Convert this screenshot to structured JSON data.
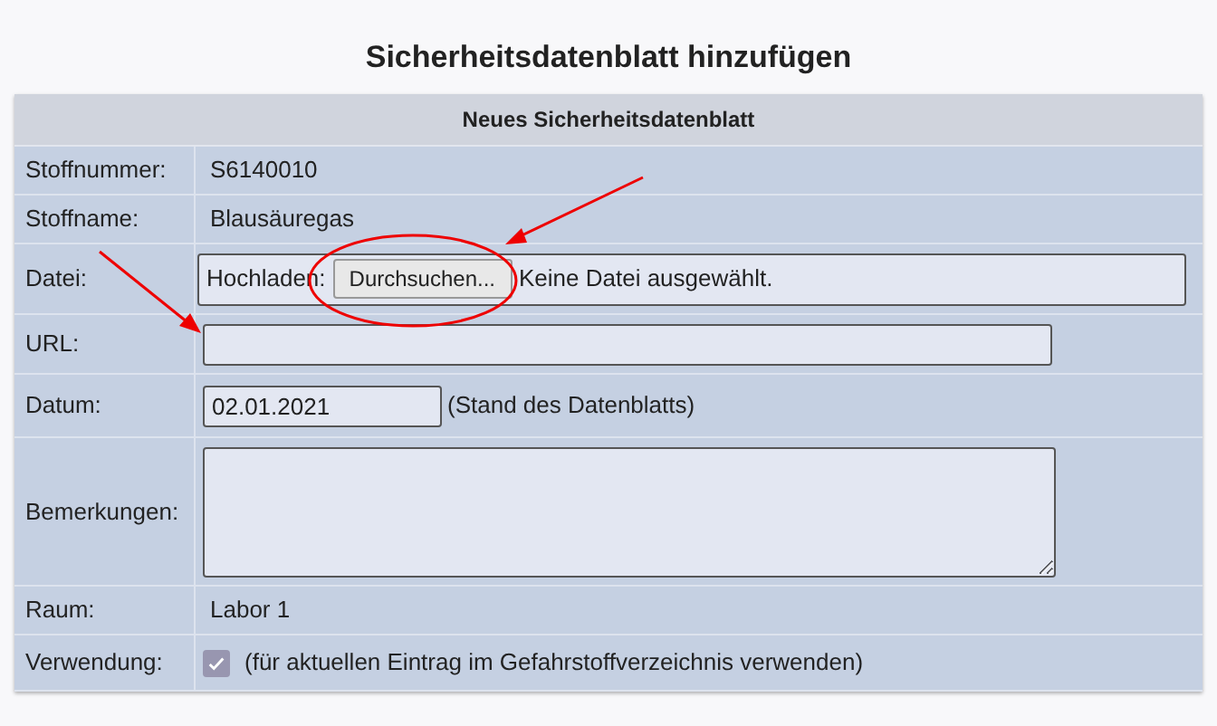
{
  "title": "Sicherheitsdatenblatt hinzufügen",
  "form": {
    "heading": "Neues Sicherheitsdatenblatt",
    "rows": [
      {
        "kind": "text",
        "label": "Stoffnummer:",
        "value": "S6140010"
      },
      {
        "kind": "text",
        "label": "Stoffname:",
        "value": "Blausäuregas"
      },
      {
        "kind": "file",
        "label": "Datei:",
        "prefix": "Hochladen:",
        "button": "Durchsuchen...",
        "status": "Keine Datei ausgewählt."
      },
      {
        "kind": "input",
        "label": "URL:"
      },
      {
        "kind": "date",
        "label": "Datum:",
        "value": "02.01.2021",
        "note": "(Stand des Datenblatts)"
      },
      {
        "kind": "textarea",
        "label": "Bemerkungen:"
      },
      {
        "kind": "text",
        "label": "Raum:",
        "value": "Labor 1"
      },
      {
        "kind": "checkbox",
        "label": "Verwendung:",
        "checked": true,
        "note": "(für aktuellen Eintrag im Gefahrstoffverzeichnis verwenden)"
      }
    ]
  }
}
